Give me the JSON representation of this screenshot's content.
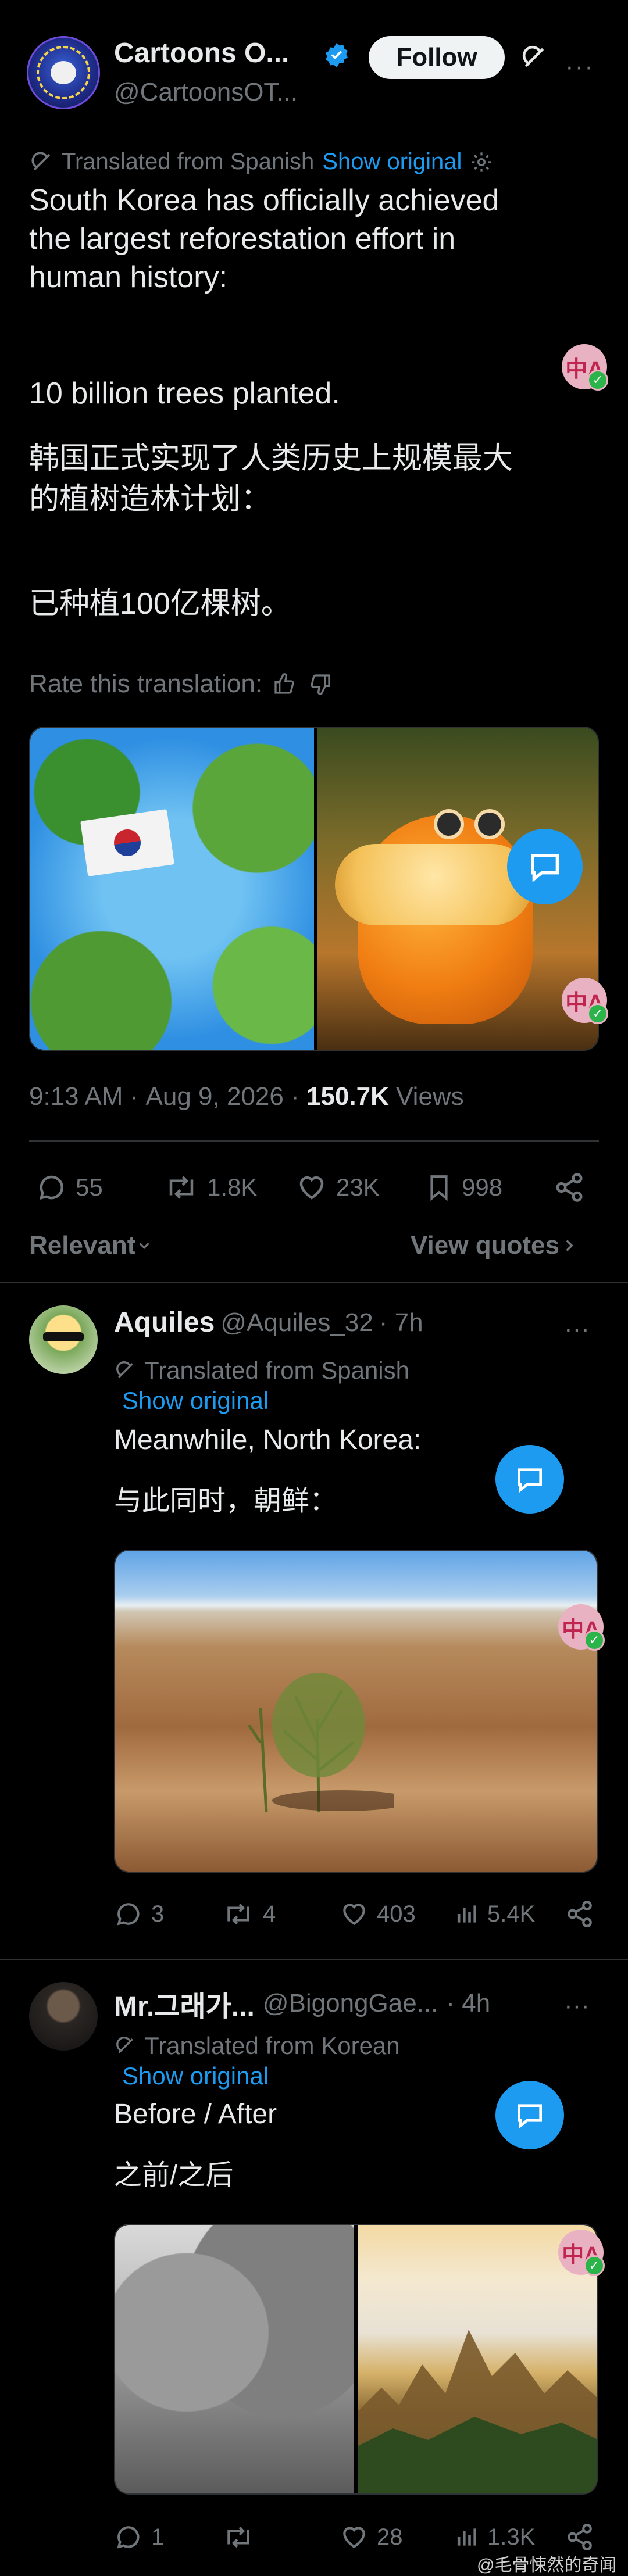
{
  "tweet": {
    "display_name": "Cartoons O...",
    "handle": "@CartoonsOT...",
    "follow_label": "Follow",
    "translated_from": "Translated from Spanish",
    "show_original": "Show original",
    "body_en_1": "South Korea has officially achieved",
    "body_en_2": "the largest reforestation effort in",
    "body_en_3": "human history:",
    "body_en_4": "10 billion trees planted.",
    "body_zh_1": "韩国正式实现了人类历史上规模最大",
    "body_zh_2": "的植树造林计划：",
    "body_zh_3": "已种植100亿棵树。",
    "rate_translation": "Rate this translation:",
    "time": "9:13 AM",
    "date": "Aug 9, 2026",
    "views_count": "150.7K",
    "views_label": "Views",
    "replies": "55",
    "reposts": "1.8K",
    "likes": "23K",
    "bookmarks": "998"
  },
  "filter": {
    "sort_label": "Relevant",
    "view_quotes": "View quotes"
  },
  "replies": [
    {
      "name": "Aquiles",
      "handle": "@Aquiles_32",
      "time": "· 7h",
      "translated_from": "Translated from Spanish",
      "show_original": "Show original",
      "text_en": "Meanwhile, North Korea:",
      "text_zh": "与此同时，朝鲜：",
      "replies": "3",
      "reposts": "4",
      "likes": "403",
      "views": "5.4K"
    },
    {
      "name": "Mr.그래가...",
      "handle": "@BigongGae...",
      "time": "· 4h",
      "translated_from": "Translated from Korean",
      "show_original": "Show original",
      "text_en": "Before / After",
      "text_zh": "之前/之后",
      "replies": "1",
      "reposts": "",
      "likes": "28",
      "views": "1.3K"
    }
  ],
  "translate_badge": "中A",
  "watermark": "@毛骨悚然的奇闻",
  "colors": {
    "accent": "#1d9bf0",
    "muted": "#71767b",
    "text": "#e7e9ea",
    "bg": "#000000"
  }
}
